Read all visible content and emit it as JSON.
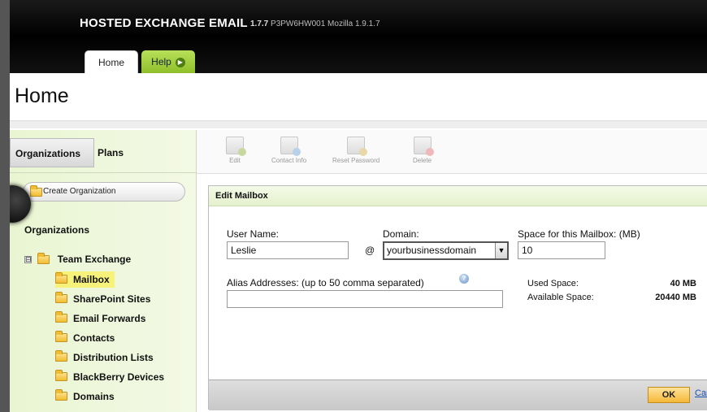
{
  "header": {
    "brand": "HOSTED EXCHANGE EMAIL",
    "version_number": "1.7.7",
    "version_build": "P3PW6HW001 Mozilla 1.9.1.7",
    "tabs": [
      {
        "label": "Home",
        "active": true
      },
      {
        "label": "Help",
        "active": false,
        "icon": "play-circle-icon"
      }
    ]
  },
  "page": {
    "title": "Home"
  },
  "sidebar": {
    "tabs": [
      {
        "label": "Organizations",
        "active": true
      },
      {
        "label": "Plans",
        "active": false
      }
    ],
    "create_button": "Create Organization",
    "heading": "Organizations",
    "tree": {
      "root": "Team Exchange",
      "toggle": "⊟",
      "items": [
        {
          "label": "Mailbox",
          "selected": true
        },
        {
          "label": "SharePoint Sites",
          "selected": false
        },
        {
          "label": "Email Forwards",
          "selected": false
        },
        {
          "label": "Contacts",
          "selected": false
        },
        {
          "label": "Distribution Lists",
          "selected": false
        },
        {
          "label": "BlackBerry Devices",
          "selected": false
        },
        {
          "label": "Domains",
          "selected": false
        }
      ]
    }
  },
  "toolbar": {
    "edit": "Edit",
    "contact_info": "Contact Info",
    "reset_password": "Reset Password",
    "delete": "Delete"
  },
  "edit_mailbox": {
    "header": "Edit Mailbox",
    "user_name_label": "User Name:",
    "user_name_value": "Leslie",
    "at": "@",
    "domain_label": "Domain:",
    "domain_value": "yourbusinessdomain",
    "space_label": "Space for this Mailbox: (MB)",
    "space_value": "10",
    "alias_label": "Alias Addresses: (up to 50 comma separated)",
    "alias_value": "",
    "used_space_label": "Used Space:",
    "used_space_value": "40 MB",
    "available_space_label": "Available Space:",
    "available_space_value": "20440 MB",
    "ok_label": "OK",
    "cancel_label": "Cancel"
  },
  "colors": {
    "sidebar_bg": "#e9f5d2",
    "help_tab": "#a5d242",
    "selected_item": "#f7f37a",
    "ok_button": "#f5b838"
  }
}
